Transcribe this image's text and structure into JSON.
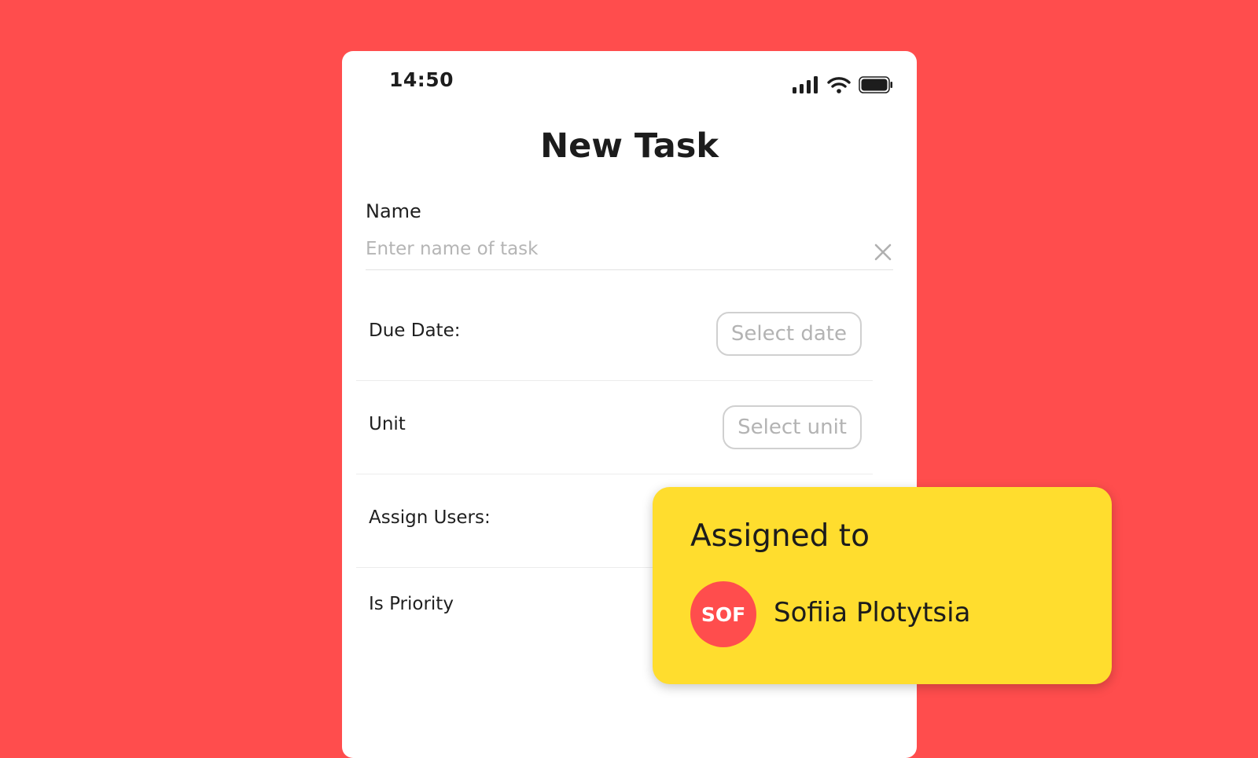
{
  "status_bar": {
    "time": "14:50"
  },
  "form": {
    "title": "New Task",
    "name": {
      "label": "Name",
      "placeholder": "Enter name of task",
      "value": ""
    },
    "due_date": {
      "label": "Due Date:",
      "button_label": "Select date"
    },
    "unit": {
      "label": "Unit",
      "button_label": "Select unit"
    },
    "assign_users": {
      "label": "Assign Users:"
    },
    "is_priority": {
      "label": "Is Priority"
    }
  },
  "assigned_card": {
    "title": "Assigned to",
    "users": [
      {
        "initials": "SOF",
        "name": "Sofiia Plotytsia"
      }
    ]
  },
  "colors": {
    "background": "#FF4D4D",
    "card": "#FFDD2E",
    "avatar": "#FF4D4D"
  },
  "icons": {
    "signal": "cellular-signal-icon",
    "wifi": "wifi-icon",
    "battery": "battery-icon",
    "clear": "close-icon"
  }
}
